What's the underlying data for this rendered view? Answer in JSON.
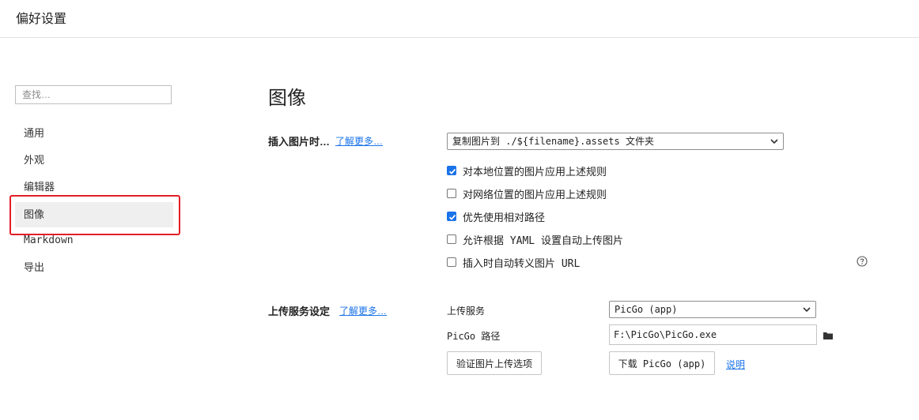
{
  "window": {
    "title": "偏好设置"
  },
  "sidebar": {
    "search_placeholder": "查找…",
    "items": [
      {
        "label": "通用"
      },
      {
        "label": "外观"
      },
      {
        "label": "编辑器"
      },
      {
        "label": "图像"
      },
      {
        "label": "Markdown"
      },
      {
        "label": "导出"
      }
    ],
    "active_index": 3
  },
  "main": {
    "heading": "图像",
    "insert_section": {
      "label": "插入图片时…",
      "learn_more": "了解更多…",
      "action_select": "复制图片到 ./${filename}.assets 文件夹",
      "options": [
        {
          "label": "对本地位置的图片应用上述规则",
          "checked": true
        },
        {
          "label": "对网络位置的图片应用上述规则",
          "checked": false
        },
        {
          "label": "优先使用相对路径",
          "checked": true
        },
        {
          "label": "允许根据 YAML 设置自动上传图片",
          "checked": false
        },
        {
          "label": "插入时自动转义图片 URL",
          "checked": false
        }
      ]
    },
    "upload_section": {
      "label": "上传服务设定",
      "learn_more": "了解更多…",
      "service_label": "上传服务",
      "service_value": "PicGo (app)",
      "path_label": "PicGo 路径",
      "path_value": "F:\\PicGo\\PicGo.exe",
      "verify_button": "验证图片上传选项",
      "download_button": "下载 PicGo (app)",
      "explain_link": "说明"
    }
  },
  "colors": {
    "accent": "#1a73e8",
    "highlight": "#e41e26",
    "active_bg": "#efefef"
  }
}
